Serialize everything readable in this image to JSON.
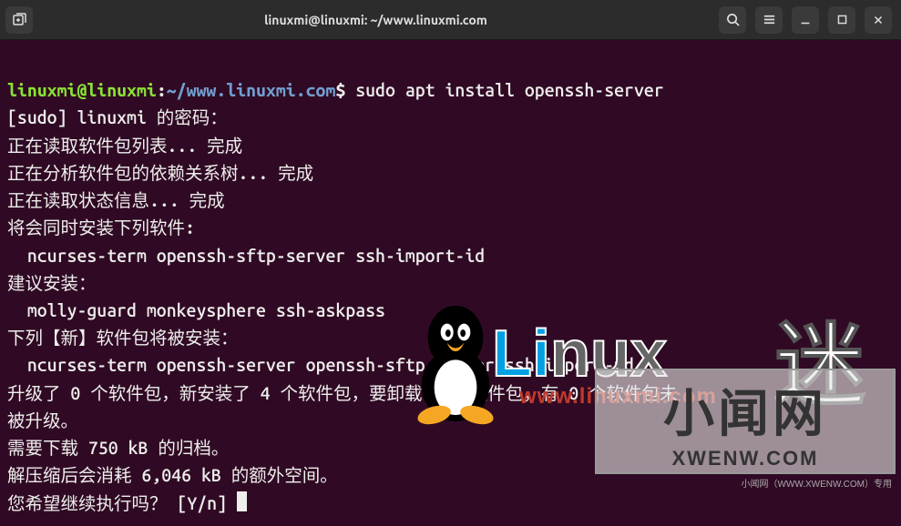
{
  "window": {
    "title": "linuxmi@linuxmi: ~/www.linuxmi.com"
  },
  "titlebar": {
    "new_tab_icon": "new-tab-icon",
    "search_icon": "search-icon",
    "menu_icon": "hamburger-icon",
    "minimize_icon": "minimize-icon",
    "maximize_icon": "maximize-icon",
    "close_icon": "close-icon"
  },
  "prompt": {
    "user_host": "linuxmi@linuxmi",
    "separator": ":",
    "path": "~/www.linuxmi.com",
    "symbol": "$",
    "command": "sudo apt install openssh-server"
  },
  "output": {
    "l01": "[sudo] linuxmi 的密码：",
    "l02": "正在读取软件包列表... 完成",
    "l03": "正在分析软件包的依赖关系树... 完成",
    "l04": "正在读取状态信息... 完成",
    "l05": "将会同时安装下列软件:",
    "l06": "  ncurses-term openssh-sftp-server ssh-import-id",
    "l07": "建议安装：",
    "l08": "  molly-guard monkeysphere ssh-askpass",
    "l09": "下列【新】软件包将被安装：",
    "l10": "  ncurses-term openssh-server openssh-sftp-server ssh-import-id",
    "l11": "升级了 0 个软件包，新安装了 4 个软件包，要卸载 0 个软件包，有 0 个软件包未",
    "l12": "被升级。",
    "l13": "需要下载 750 kB 的归档。",
    "l14": "解压缩后会消耗 6,046 kB 的额外空间。",
    "l15": "您希望继续执行吗？ [Y/n] "
  },
  "watermark1": {
    "text_linux": "Linux",
    "text_mi": "迷",
    "url": "www.linuxmi.com"
  },
  "watermark2": {
    "cn": "小闻网",
    "en": "XWENW.COM",
    "foot": "小闻网（WWW.XWENW.COM）专用"
  }
}
